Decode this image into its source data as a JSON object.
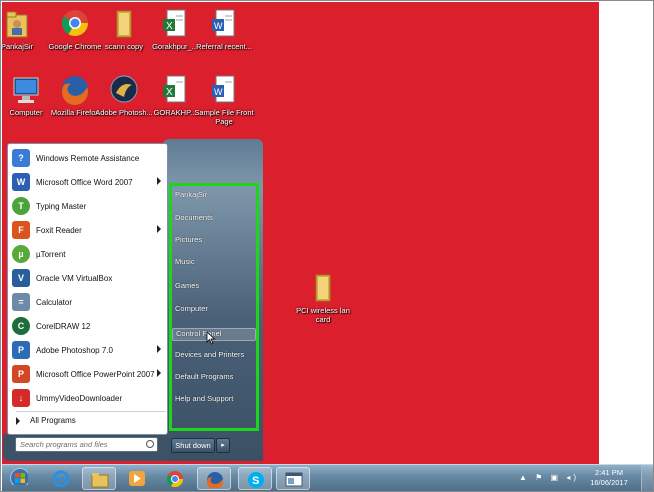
{
  "desktop_icons": [
    {
      "label": "PankajSir",
      "icon": "user-folder-icon"
    },
    {
      "label": "Google Chrome",
      "icon": "chrome-icon"
    },
    {
      "label": "scann copy",
      "icon": "folder-icon"
    },
    {
      "label": "Gorakhpur_...",
      "icon": "excel-file-icon"
    },
    {
      "label": "Referral recent...",
      "icon": "word-file-icon"
    },
    {
      "label": "Computer",
      "icon": "computer-icon"
    },
    {
      "label": "Mozilla Firefox",
      "icon": "firefox-icon"
    },
    {
      "label": "Adobe Photosh...",
      "icon": "photoshop-icon"
    },
    {
      "label": "GORAKHP...",
      "icon": "excel-file-icon"
    },
    {
      "label": "Sample File Front Page",
      "icon": "word-file-icon"
    },
    {
      "label": "PCI wireless lan card",
      "icon": "folder-icon"
    }
  ],
  "start_menu": {
    "programs": [
      {
        "label": "Windows Remote Assistance",
        "icon": "remote-assistance-icon",
        "color": "#3a7bd5",
        "submenu": false
      },
      {
        "label": "Microsoft Office Word 2007",
        "icon": "word-icon",
        "color": "#2b5fb4",
        "submenu": true
      },
      {
        "label": "Typing Master",
        "icon": "typing-master-icon",
        "color": "#4aa33b",
        "submenu": false
      },
      {
        "label": "Foxit Reader",
        "icon": "foxit-icon",
        "color": "#d9541e",
        "submenu": true
      },
      {
        "label": "µTorrent",
        "icon": "utorrent-icon",
        "color": "#59a83a",
        "submenu": false
      },
      {
        "label": "Oracle VM VirtualBox",
        "icon": "virtualbox-icon",
        "color": "#2a5d9c",
        "submenu": false
      },
      {
        "label": "Calculator",
        "icon": "calculator-icon",
        "color": "#6e8aa8",
        "submenu": false
      },
      {
        "label": "CorelDRAW 12",
        "icon": "coreldraw-icon",
        "color": "#1d6e3a",
        "submenu": false
      },
      {
        "label": "Adobe Photoshop 7.0",
        "icon": "photoshop-icon",
        "color": "#2d6cb5",
        "submenu": true
      },
      {
        "label": "Microsoft Office PowerPoint 2007",
        "icon": "powerpoint-icon",
        "color": "#d24726",
        "submenu": true
      },
      {
        "label": "UmmyVideoDownloader",
        "icon": "download-icon",
        "color": "#d42a2a",
        "submenu": false
      }
    ],
    "all_programs": "All Programs",
    "search_placeholder": "Search programs and files",
    "right_items": [
      "PankajSir",
      "Documents",
      "Pictures",
      "Music",
      "Games",
      "Computer",
      "Control Panel",
      "Devices and Printers",
      "Default Programs",
      "Help and Support"
    ],
    "shutdown": "Shut down"
  },
  "taskbar": {
    "items": [
      "start-orb-icon",
      "internet-explorer-icon",
      "explorer-icon",
      "media-player-icon",
      "chrome-icon",
      "firefox-icon",
      "skype-icon",
      "window-icon"
    ],
    "time": "2:41 PM",
    "date": "16/06/2017"
  },
  "colors": {
    "desktop": "#dc1f2d",
    "highlight_border": "#1bd61b"
  }
}
